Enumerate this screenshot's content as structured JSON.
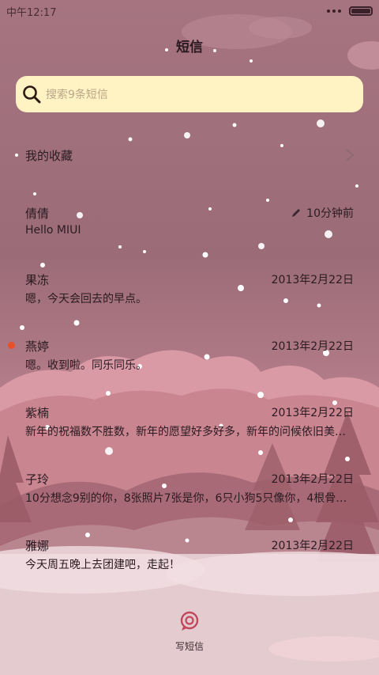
{
  "status_bar": {
    "time": "中午12:17"
  },
  "header": {
    "title": "短信"
  },
  "search": {
    "placeholder": "搜索9条短信"
  },
  "favorites": {
    "label": "我的收藏"
  },
  "conversations": [
    {
      "name": "倩倩",
      "time": "10分钟前",
      "preview": "Hello MIUI",
      "draft": true,
      "unread": false
    },
    {
      "name": "果冻",
      "time": "2013年2月22日",
      "preview": "嗯，今天会回去的早点。",
      "draft": false,
      "unread": false
    },
    {
      "name": "燕婷",
      "time": "2013年2月22日",
      "preview": "嗯。收到啦。同乐同乐。",
      "draft": false,
      "unread": true
    },
    {
      "name": "紫楠",
      "time": "2013年2月22日",
      "preview": "新年的祝福数不胜数，新年的愿望好多好多，新年的问候依旧美…",
      "draft": false,
      "unread": false
    },
    {
      "name": "子玲",
      "time": "2013年2月22日",
      "preview": "10分想念9别的你，8张照片7张是你，6只小狗5只像你，4根骨…",
      "draft": false,
      "unread": false
    },
    {
      "name": "雅娜",
      "time": "2013年2月22日",
      "preview": "今天周五晚上去团建吧，走起！",
      "draft": false,
      "unread": false
    }
  ],
  "compose": {
    "label": "写短信"
  },
  "colors": {
    "unread_dot": "#e8502a",
    "search_bg": "#fff3c4"
  }
}
